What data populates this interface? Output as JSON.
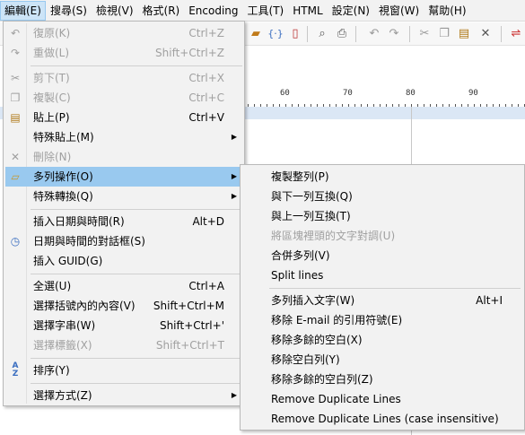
{
  "menubar": {
    "items": [
      "編輯(E)",
      "搜尋(S)",
      "檢視(V)",
      "格式(R)",
      "Encoding",
      "工具(T)",
      "HTML",
      "設定(N)",
      "視窗(W)",
      "幫助(H)"
    ]
  },
  "ruler": {
    "labels": [
      "60",
      "70",
      "80",
      "90"
    ]
  },
  "edit_menu": {
    "undo": {
      "label": "復原(K)",
      "shortcut": "Ctrl+Z"
    },
    "redo": {
      "label": "重做(L)",
      "shortcut": "Shift+Ctrl+Z"
    },
    "cut": {
      "label": "剪下(T)",
      "shortcut": "Ctrl+X"
    },
    "copy": {
      "label": "複製(C)",
      "shortcut": "Ctrl+C"
    },
    "paste": {
      "label": "貼上(P)",
      "shortcut": "Ctrl+V"
    },
    "paste_special": {
      "label": "特殊貼上(M)"
    },
    "delete": {
      "label": "刪除(N)"
    },
    "multi_line": {
      "label": "多列操作(O)"
    },
    "special_convert": {
      "label": "特殊轉換(Q)"
    },
    "insert_datetime": {
      "label": "插入日期與時間(R)",
      "shortcut": "Alt+D"
    },
    "datetime_dialog": {
      "label": "日期與時間的對話框(S)"
    },
    "insert_guid": {
      "label": "插入 GUID(G)"
    },
    "select_all": {
      "label": "全選(U)",
      "shortcut": "Ctrl+A"
    },
    "select_brackets": {
      "label": "選擇括號內的內容(V)",
      "shortcut": "Shift+Ctrl+M"
    },
    "select_string": {
      "label": "選擇字串(W)",
      "shortcut": "Shift+Ctrl+'"
    },
    "select_tag": {
      "label": "選擇標籤(X)",
      "shortcut": "Shift+Ctrl+T"
    },
    "sort": {
      "label": "排序(Y)"
    },
    "select_mode": {
      "label": "選擇方式(Z)"
    }
  },
  "submenu": {
    "duplicate_line": {
      "label": "複製整列(P)"
    },
    "swap_down": {
      "label": "與下一列互換(Q)"
    },
    "swap_up": {
      "label": "與上一列互換(T)"
    },
    "align_block": {
      "label": "將區塊裡頭的文字對調(U)"
    },
    "merge_lines": {
      "label": "合併多列(V)"
    },
    "split_lines": {
      "label": "Split lines"
    },
    "insert_text": {
      "label": "多列插入文字(W)",
      "shortcut": "Alt+I"
    },
    "remove_email_quote": {
      "label": "移除 E-mail 的引用符號(E)"
    },
    "remove_extra_spaces": {
      "label": "移除多餘的空白(X)"
    },
    "remove_blank_lines": {
      "label": "移除空白列(Y)"
    },
    "remove_extra_blank_lines": {
      "label": "移除多餘的空白列(Z)"
    },
    "remove_duplicates": {
      "label": "Remove Duplicate Lines"
    },
    "remove_duplicates_ci": {
      "label": "Remove Duplicate Lines (case insensitive)"
    }
  }
}
